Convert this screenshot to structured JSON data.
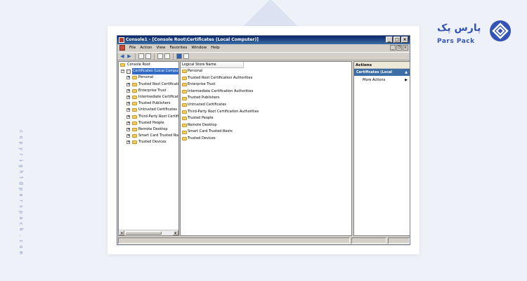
{
  "window": {
    "title": "Console1 - [Console Root\\Certificates (Local Computer)]",
    "min": "_",
    "max": "□",
    "close": "×"
  },
  "menu": [
    "File",
    "Action",
    "View",
    "Favorites",
    "Window",
    "Help"
  ],
  "mdi": {
    "min": "_",
    "restore": "❐",
    "close": "×"
  },
  "tree": {
    "root": "Console Root",
    "cert": "Certificates (Local Computer)",
    "expander_minus": "−",
    "expander_plus": "+",
    "children": [
      "Personal",
      "Trusted Root Certification Aut",
      "Enterprise Trust",
      "Intermediate Certification Aut",
      "Trusted Publishers",
      "Untrusted Certificates",
      "Third-Party Root Certification",
      "Trusted People",
      "Remote Desktop",
      "Smart Card Trusted Roots",
      "Trusted Devices"
    ],
    "scroll_left": "◂",
    "scroll_right": "▸"
  },
  "list": {
    "header": "Logical Store Name",
    "items": [
      "Personal",
      "Trusted Root Certification Authorities",
      "Enterprise Trust",
      "Intermediate Certification Authorities",
      "Trusted Publishers",
      "Untrusted Certificates",
      "Third-Party Root Certification Authorities",
      "Trusted People",
      "Remote Desktop",
      "Smart Card Trusted Roots",
      "Trusted Devices"
    ]
  },
  "actions": {
    "header": "Actions",
    "section": "Certificates (Local Computer)",
    "section_caret": "▲",
    "more": "More Actions",
    "more_caret": "▶"
  },
  "branding": {
    "name_fa": "پارس پک",
    "name_en": "Pars Pack",
    "copyright": "copyright@parspack.com",
    "color": "#3354b6"
  }
}
